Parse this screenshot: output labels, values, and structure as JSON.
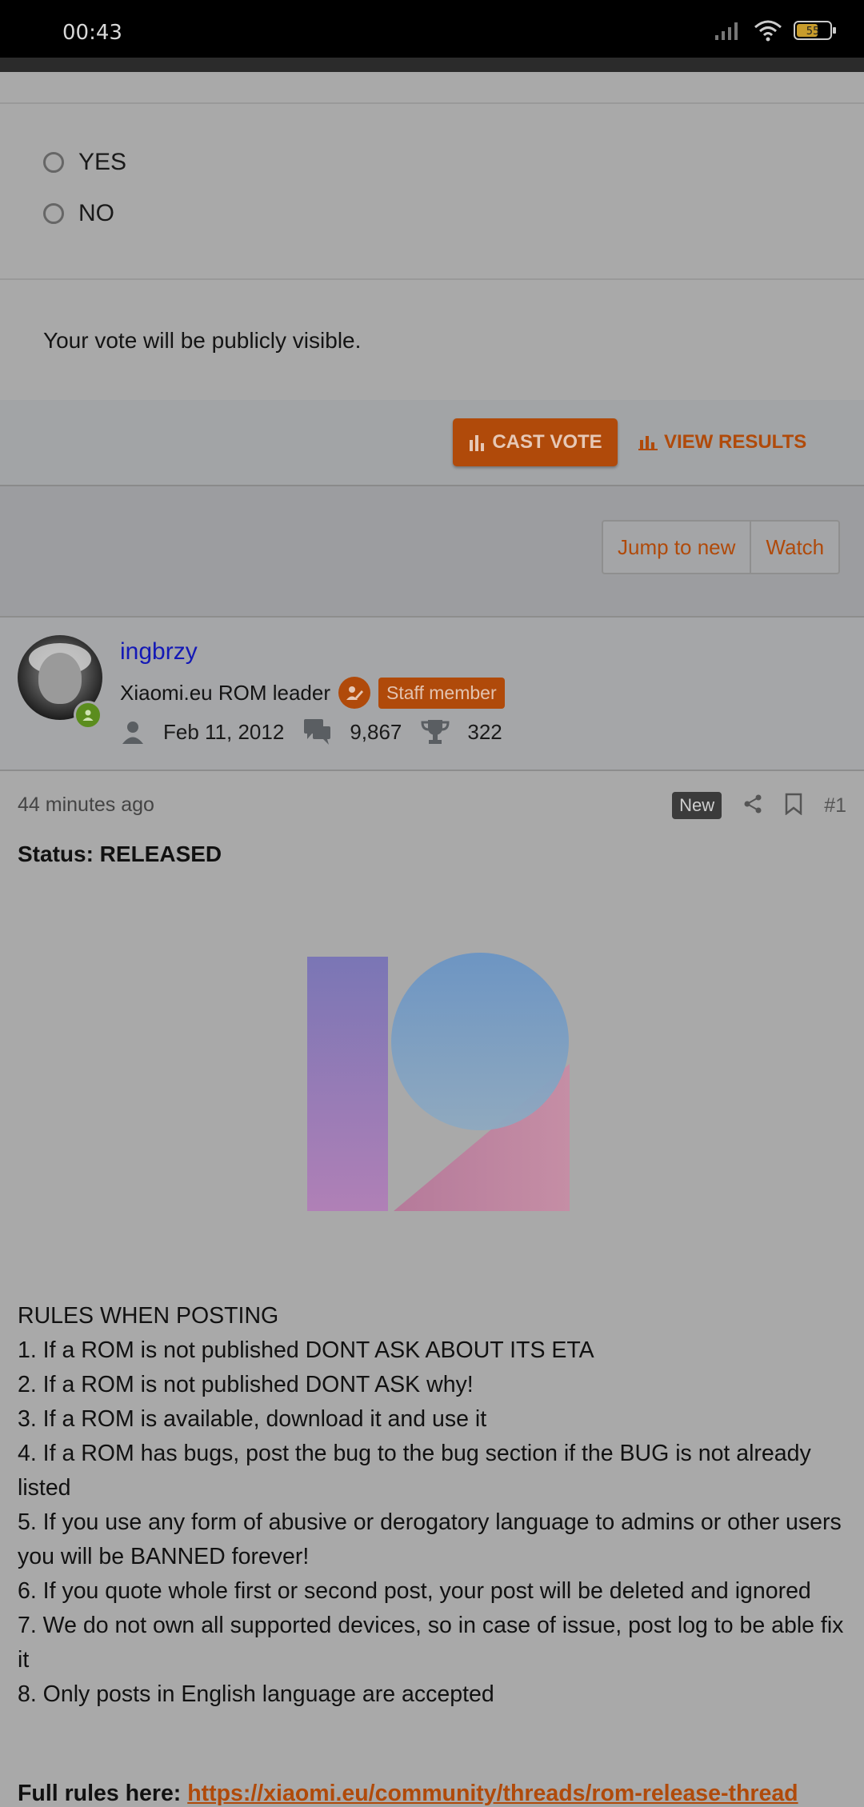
{
  "status_bar": {
    "time": "00:43",
    "battery": "55"
  },
  "poll": {
    "options": [
      "YES",
      "NO"
    ],
    "note": "Your vote will be publicly visible.",
    "cast_vote_label": "CAST VOTE",
    "view_results_label": "VIEW RESULTS"
  },
  "thread_actions": {
    "jump_label": "Jump to new",
    "watch_label": "Watch"
  },
  "author": {
    "name": "ingbrzy",
    "title": "Xiaomi.eu ROM leader",
    "staff_label": "Staff member",
    "joined": "Feb 11, 2012",
    "messages": "9,867",
    "trophies": "322"
  },
  "post": {
    "time": "44 minutes ago",
    "new_label": "New",
    "number": "#1",
    "status": "Status: RELEASED",
    "rules_heading": "RULES WHEN POSTING",
    "rules": [
      "1. If a ROM is not published DONT ASK ABOUT ITS ETA",
      "2. If a ROM is not published DONT ASK why!",
      "3. If a ROM is available, download it and use it",
      "4. If a ROM has bugs, post the bug to the bug section if the BUG is not already listed",
      "5. If you use any form of abusive or derogatory language to admins or other users you will be BANNED forever!",
      "6. If you quote whole first or second post, your post will be deleted and ignored",
      "7. We do not own all supported devices, so in case of issue, post log to be able fix it",
      "8. Only posts in English language are accepted"
    ],
    "full_rules_label": "Full rules here:",
    "full_rules_link": "https://xiaomi.eu/community/threads/rom-release-thread"
  },
  "colors": {
    "accent": "#b04a0a",
    "username": "#1419b6",
    "overlay_bg": "#a9a9a9"
  }
}
